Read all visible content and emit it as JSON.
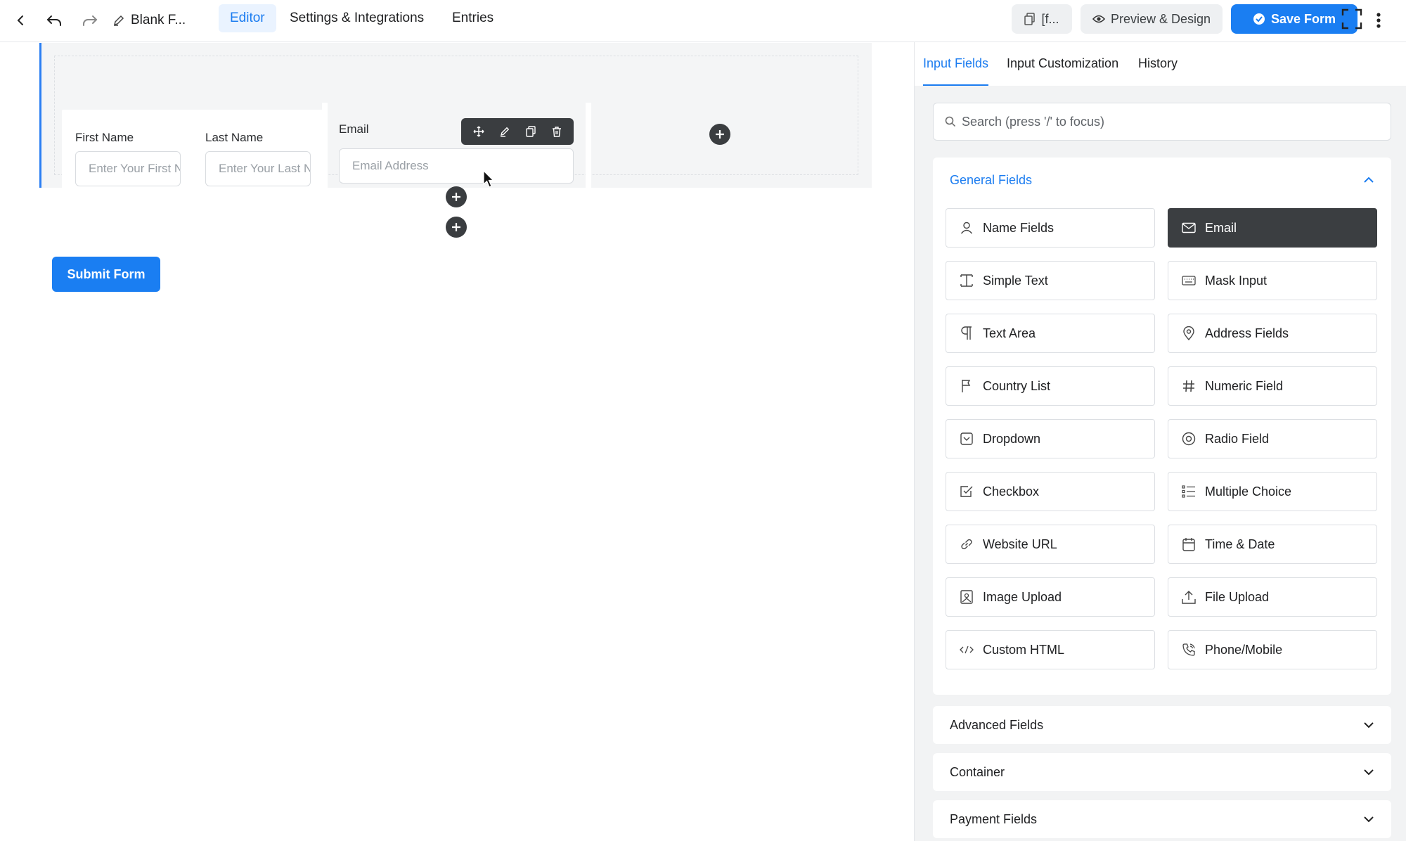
{
  "topbar": {
    "form_title": "Blank F...",
    "tabs": [
      {
        "label": "Editor",
        "active": true
      },
      {
        "label": "Settings & Integrations",
        "active": false
      },
      {
        "label": "Entries",
        "active": false
      }
    ],
    "shortcode_label": "[f...",
    "preview_label": "Preview & Design",
    "save_label": "Save Form"
  },
  "form": {
    "first_name": {
      "label": "First Name",
      "placeholder": "Enter Your First Name"
    },
    "last_name": {
      "label": "Last Name",
      "placeholder": "Enter Your Last Name"
    },
    "email": {
      "label": "Email",
      "placeholder": "Email Address"
    },
    "submit_label": "Submit Form"
  },
  "sidebar": {
    "tabs": [
      {
        "label": "Input Fields",
        "active": true
      },
      {
        "label": "Input Customization",
        "active": false
      },
      {
        "label": "History",
        "active": false
      }
    ],
    "search_placeholder": "Search (press '/' to focus)",
    "general": {
      "title": "General Fields",
      "fields": [
        {
          "label": "Name Fields",
          "icon": "user-icon"
        },
        {
          "label": "Email",
          "icon": "envelope-icon",
          "selected": true
        },
        {
          "label": "Simple Text",
          "icon": "text-cursor-icon"
        },
        {
          "label": "Mask Input",
          "icon": "keyboard-icon"
        },
        {
          "label": "Text Area",
          "icon": "paragraph-icon"
        },
        {
          "label": "Address Fields",
          "icon": "map-pin-icon"
        },
        {
          "label": "Country List",
          "icon": "flag-icon"
        },
        {
          "label": "Numeric Field",
          "icon": "hash-icon"
        },
        {
          "label": "Dropdown",
          "icon": "dropdown-icon"
        },
        {
          "label": "Radio Field",
          "icon": "radio-icon"
        },
        {
          "label": "Checkbox",
          "icon": "checkbox-icon"
        },
        {
          "label": "Multiple Choice",
          "icon": "list-icon"
        },
        {
          "label": "Website URL",
          "icon": "link-icon"
        },
        {
          "label": "Time & Date",
          "icon": "calendar-icon"
        },
        {
          "label": "Image Upload",
          "icon": "image-icon"
        },
        {
          "label": "File Upload",
          "icon": "upload-icon"
        },
        {
          "label": "Custom HTML",
          "icon": "code-icon"
        },
        {
          "label": "Phone/Mobile",
          "icon": "phone-icon"
        }
      ]
    },
    "collapsed_sections": [
      {
        "title": "Advanced Fields"
      },
      {
        "title": "Container"
      },
      {
        "title": "Payment Fields"
      }
    ]
  }
}
